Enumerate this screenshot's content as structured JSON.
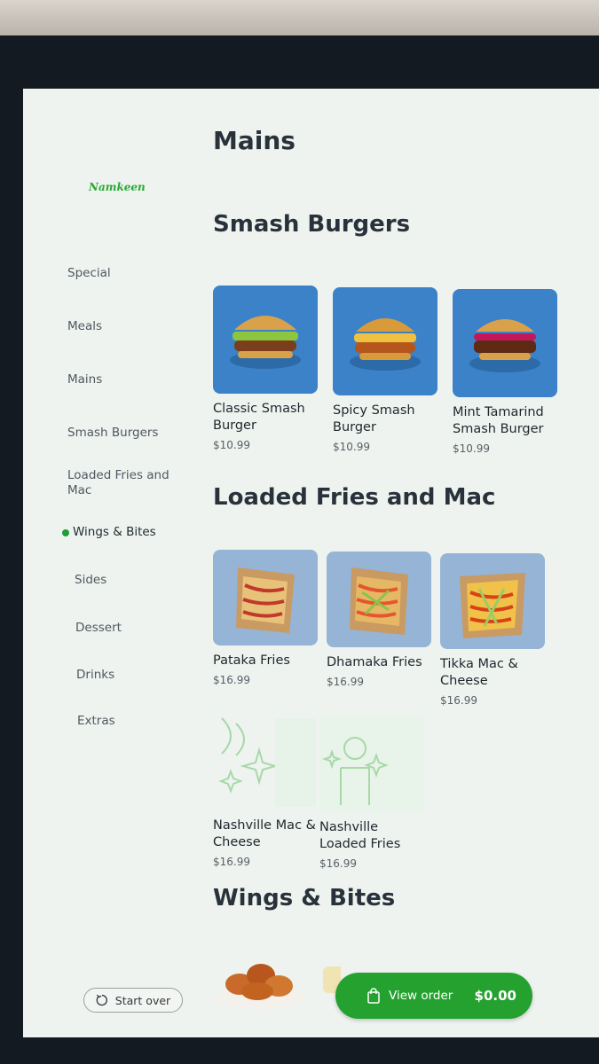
{
  "brand": {
    "logo_text": "Namkeen"
  },
  "sidebar": {
    "items": [
      {
        "label": "Special",
        "active": false
      },
      {
        "label": "Meals",
        "active": false
      },
      {
        "label": "Mains",
        "active": false
      },
      {
        "label": "Smash Burgers",
        "active": false
      },
      {
        "label": "Loaded Fries and Mac",
        "active": false
      },
      {
        "label": "Wings & Bites",
        "active": true
      },
      {
        "label": "Sides",
        "active": false
      },
      {
        "label": "Dessert",
        "active": false
      },
      {
        "label": "Drinks",
        "active": false
      },
      {
        "label": "Extras",
        "active": false
      }
    ]
  },
  "main": {
    "title": "Mains",
    "sections": [
      {
        "title": "Smash Burgers",
        "items": [
          {
            "name": "Classic Smash Burger",
            "price": "$10.99",
            "image": "burger-photo"
          },
          {
            "name": "Spicy Smash Burger",
            "price": "$10.99",
            "image": "burger-photo"
          },
          {
            "name": "Mint Tamarind Smash Burger",
            "price": "$10.99",
            "image": "burger-photo"
          }
        ]
      },
      {
        "title": "Loaded Fries and Mac",
        "items": [
          {
            "name": "Pataka Fries",
            "price": "$16.99",
            "image": "fries-photo"
          },
          {
            "name": "Dhamaka Fries",
            "price": "$16.99",
            "image": "fries-photo"
          },
          {
            "name": "Tikka Mac & Cheese",
            "price": "$16.99",
            "image": "fries-photo"
          },
          {
            "name": "Nashville Mac & Cheese",
            "price": "$16.99",
            "image": "placeholder-illustration"
          },
          {
            "name": "Nashville Loaded Fries",
            "price": "$16.99",
            "image": "placeholder-illustration"
          }
        ]
      },
      {
        "title": "Wings & Bites",
        "items": []
      }
    ]
  },
  "footer": {
    "start_over_label": "Start over",
    "start_over_icon": "refresh-icon",
    "view_order_label": "View order",
    "view_order_icon": "shopping-bag-icon",
    "order_total": "$0.00"
  },
  "colors": {
    "accent_green": "#24a12f",
    "brand_green": "#2aa837",
    "burger_bg": "#3b82c9",
    "fries_bg": "#95b4d6"
  }
}
